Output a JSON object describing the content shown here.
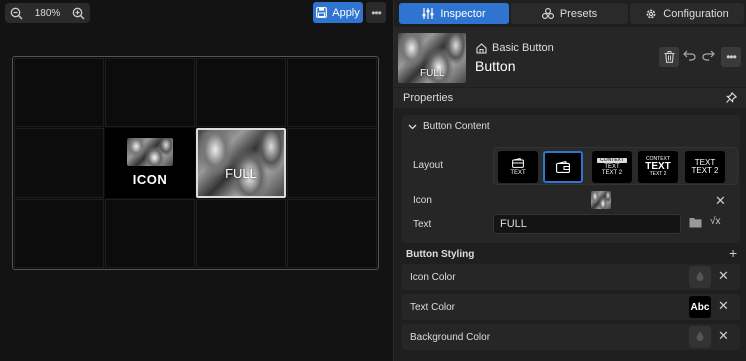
{
  "toolbar": {
    "zoom": "180%",
    "apply_label": "Apply"
  },
  "canvas": {
    "icon_button_label": "ICON",
    "full_button_label": "FULL"
  },
  "tabs": [
    {
      "label": "Inspector",
      "icon": "sliders-icon",
      "active": true
    },
    {
      "label": "Presets",
      "icon": "presets-icon",
      "active": false
    },
    {
      "label": "Configuration",
      "icon": "gear-icon",
      "active": false
    }
  ],
  "header": {
    "thumb_text": "FULL",
    "component_type": "Basic Button",
    "component_name": "Button"
  },
  "properties": {
    "title": "Properties",
    "button_content": {
      "title": "Button Content",
      "layout_label": "Layout",
      "layout_options": [
        {
          "name": "icon-text",
          "text": "TEXT"
        },
        {
          "name": "icon-only",
          "selected": true
        },
        {
          "name": "context-text",
          "pill": "CONTEXT",
          "lines": [
            "TEXT",
            "TEXT 2"
          ]
        },
        {
          "name": "context-big",
          "top": "CONTEXT",
          "big": "TEXT",
          "bottom": "TEXT 2"
        },
        {
          "name": "two-line",
          "lines": [
            "TEXT",
            "TEXT 2"
          ]
        }
      ],
      "icon_label": "Icon",
      "text_label": "Text",
      "text_value": "FULL"
    },
    "button_styling": {
      "title": "Button Styling",
      "rows": [
        {
          "label": "Icon Color"
        },
        {
          "label": "Text Color",
          "swatch_text": "Abc"
        },
        {
          "label": "Background Color"
        }
      ]
    }
  },
  "colors": {
    "accent": "#2f74d0",
    "panel_bg": "#1f1f1f",
    "canvas_bg": "#131313"
  }
}
